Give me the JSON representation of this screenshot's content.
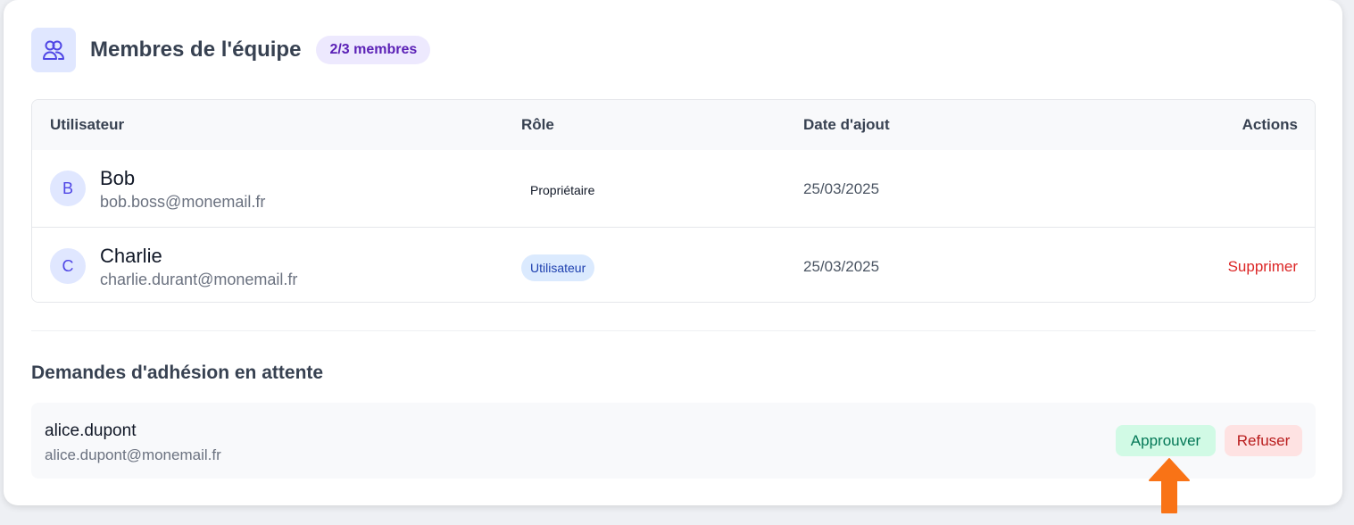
{
  "header": {
    "title": "Membres de l'équipe",
    "member_count": "2/3 membres",
    "icon": "users-icon"
  },
  "table": {
    "columns": [
      "Utilisateur",
      "Rôle",
      "Date d'ajout",
      "Actions"
    ],
    "rows": [
      {
        "initial": "B",
        "name": "Bob",
        "email": "bob.boss@monemail.fr",
        "role": "Propriétaire",
        "date": "25/03/2025",
        "action": ""
      },
      {
        "initial": "C",
        "name": "Charlie",
        "email": "charlie.durant@monemail.fr",
        "role": "Utilisateur",
        "date": "25/03/2025",
        "action": "Supprimer"
      }
    ]
  },
  "pending": {
    "title": "Demandes d'adhésion en attente",
    "requests": [
      {
        "username": "alice.dupont",
        "email": "alice.dupont@monemail.fr",
        "approve_label": "Approuver",
        "refuse_label": "Refuser"
      }
    ]
  },
  "colors": {
    "accent": "#4f46e5",
    "approve": "#047857",
    "danger": "#dc2626",
    "arrow": "#f97316"
  }
}
